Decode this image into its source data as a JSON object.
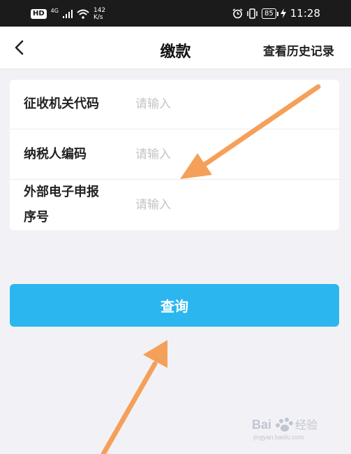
{
  "status_bar": {
    "hd": "HD",
    "network_gen": "4G",
    "speed_value": "142",
    "speed_unit": "K/s",
    "battery": "85",
    "time": "11:28"
  },
  "header": {
    "title": "缴款",
    "history_link": "查看历史记录"
  },
  "form": {
    "rows": [
      {
        "label": "征收机关代码",
        "value": "",
        "placeholder": "请输入"
      },
      {
        "label": "纳税人编码",
        "value": "",
        "placeholder": "请输入"
      },
      {
        "label_line1": "外部电子申报",
        "label_line2": "序号",
        "value": "",
        "placeholder": "请输入"
      }
    ]
  },
  "query_button": {
    "label": "查询"
  },
  "annotation_color": "#f5a05a",
  "accent_color": "#2bb6ef",
  "watermark": {
    "text": "Bai 经验",
    "subtext": "jingyan.baidu.com"
  }
}
